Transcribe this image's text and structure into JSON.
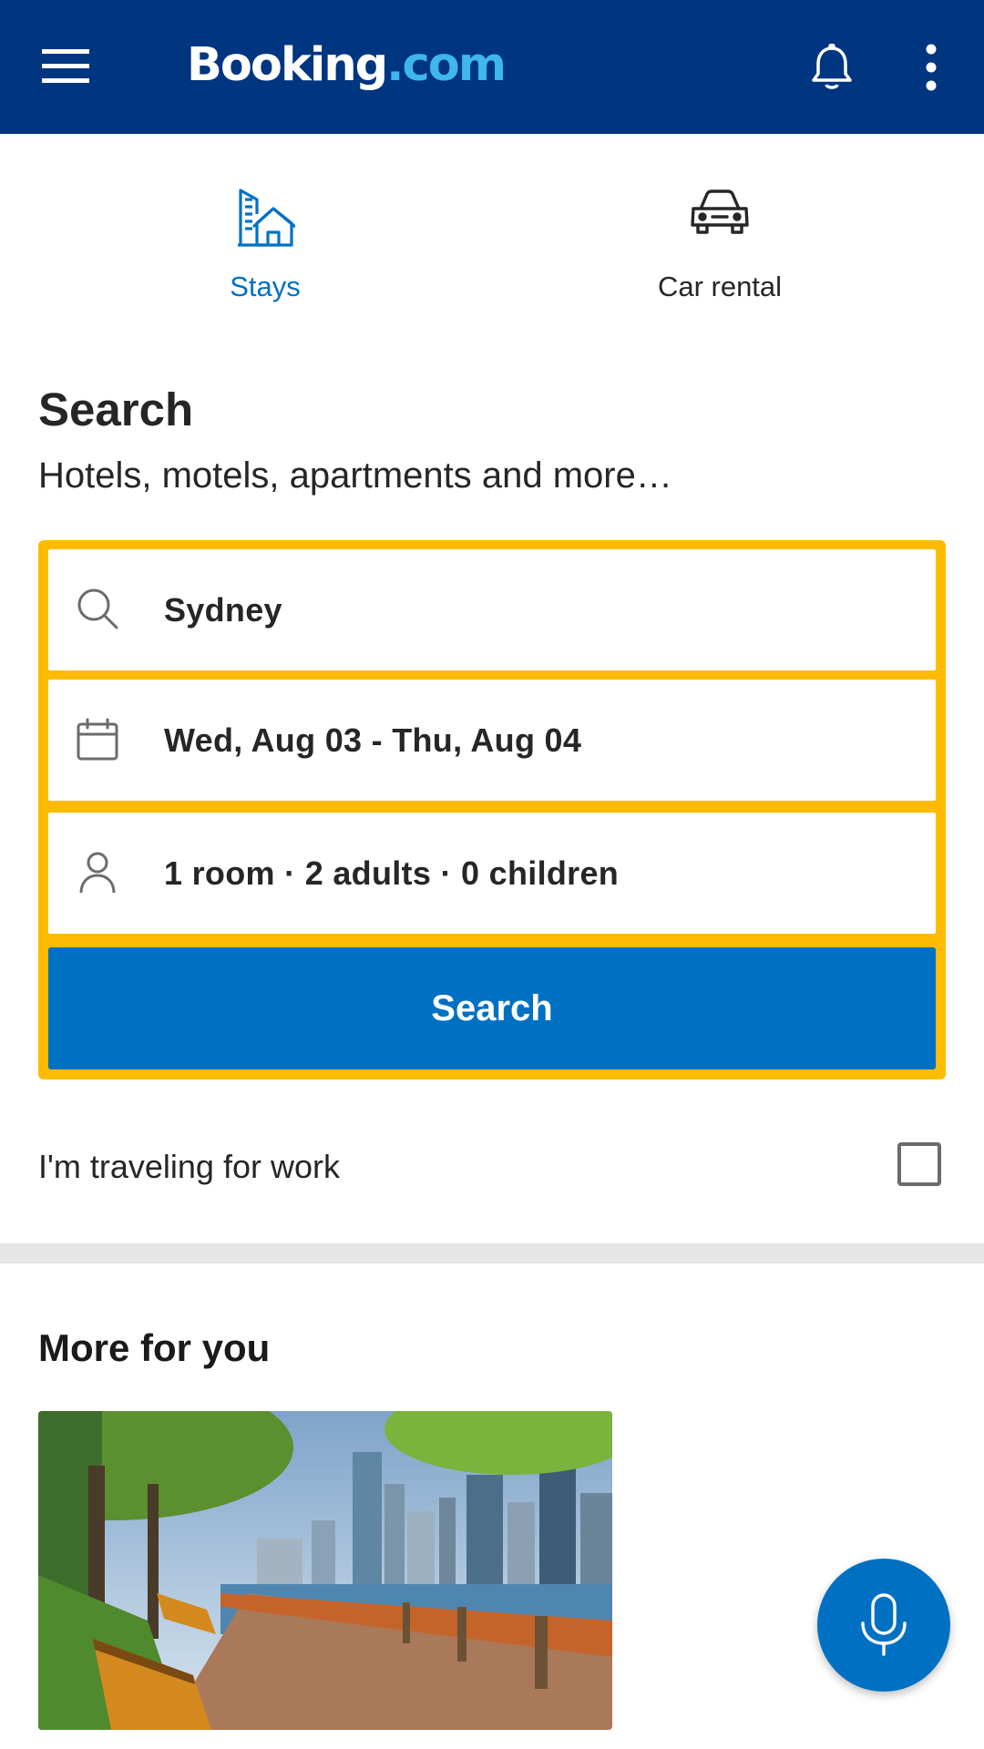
{
  "header": {
    "logo_part1": "Booking",
    "logo_part2": ".com",
    "icons": [
      "menu-icon",
      "bell-icon",
      "more-vert-icon"
    ]
  },
  "tabs": [
    {
      "label": "Stays",
      "icon": "hotel-icon",
      "active": true
    },
    {
      "label": "Car rental",
      "icon": "car-icon",
      "active": false
    }
  ],
  "search": {
    "title": "Search",
    "subtitle": "Hotels, motels, apartments and more…",
    "destination": "Sydney",
    "dates": "Wed, Aug 03 - Thu, Aug 04",
    "occupancy": "1 room · 2 adults · 0 children",
    "button_label": "Search"
  },
  "work_travel": {
    "label": "I'm traveling for work",
    "checked": false
  },
  "more_for_you": {
    "title": "More for you"
  },
  "colors": {
    "brand_dark_blue": "#003580",
    "action_blue": "#0071c2",
    "logo_light_blue": "#3fb6ee",
    "searchbox_yellow": "#febb02"
  }
}
